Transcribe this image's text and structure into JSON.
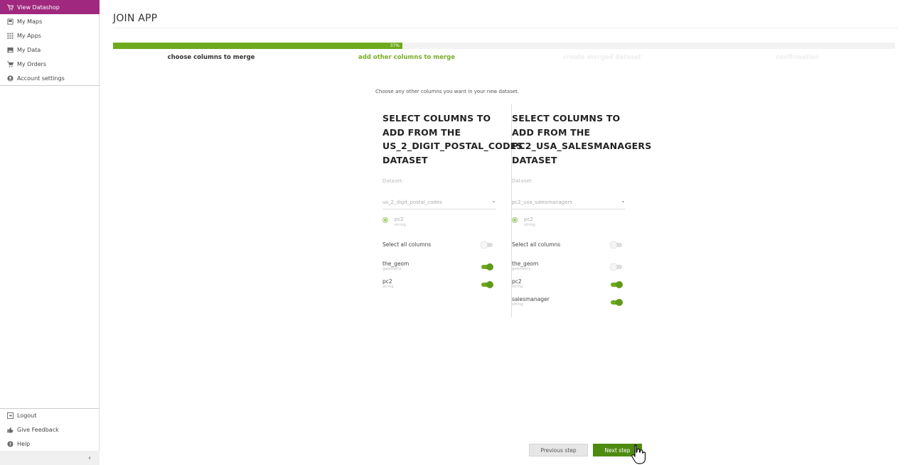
{
  "sidebar": {
    "items": [
      {
        "label": "View Datashop",
        "icon": "cart-icon",
        "active": true
      },
      {
        "label": "My Maps",
        "icon": "maps-icon"
      },
      {
        "label": "My Apps",
        "icon": "apps-grid-icon"
      },
      {
        "label": "My Data",
        "icon": "image-data-icon"
      },
      {
        "label": "My Orders",
        "icon": "cart-icon"
      },
      {
        "label": "Account settings",
        "icon": "account-icon"
      }
    ],
    "bottom": [
      {
        "label": "Logout",
        "icon": "logout-icon"
      },
      {
        "label": "Give Feedback",
        "icon": "thumbs-up-icon"
      },
      {
        "label": "Help",
        "icon": "help-icon"
      }
    ],
    "collapse": "‹"
  },
  "page": {
    "title": "JOIN APP"
  },
  "progress": {
    "percent": 37,
    "label": "37%"
  },
  "steps": [
    {
      "label": "choose columns to merge",
      "state": "done"
    },
    {
      "label": "add other columns to merge",
      "state": "current"
    },
    {
      "label": "create merged dataset",
      "state": "future"
    },
    {
      "label": "confirmation",
      "state": "future"
    }
  ],
  "intro": "Choose any other columns you want in your new dataset.",
  "columns": [
    {
      "title_lines": [
        "SELECT COLUMNS TO",
        "ADD FROM THE",
        "US_2_DIGIT_POSTAL_CODES",
        "DATASET"
      ],
      "dataset_label": "Dataset:",
      "dataset_value": "us_2_digit_postal_codes",
      "key": {
        "name": "pc2",
        "type": "string"
      },
      "select_all": {
        "label": "Select all columns",
        "on": false
      },
      "fields": [
        {
          "name": "the_geom",
          "type": "geometry",
          "on": true
        },
        {
          "name": "pc2",
          "type": "string",
          "on": true
        }
      ]
    },
    {
      "title_lines": [
        "SELECT COLUMNS TO",
        "ADD FROM THE",
        "PC2_USA_SALESMANAGERS",
        "DATASET"
      ],
      "dataset_label": "Dataset:",
      "dataset_value": "pc2_usa_salesmanagers",
      "key": {
        "name": "pc2",
        "type": "string"
      },
      "select_all": {
        "label": "Select all columns",
        "on": false
      },
      "fields": [
        {
          "name": "the_geom",
          "type": "geometry",
          "on": false
        },
        {
          "name": "pc2",
          "type": "string",
          "on": true
        },
        {
          "name": "salesmanager",
          "type": "string",
          "on": true
        }
      ]
    }
  ],
  "buttons": {
    "previous": "Previous step",
    "next": "Next step"
  },
  "colors": {
    "brand": "#a0297f",
    "accent": "#6eaa1e",
    "next_button": "#4f8a10"
  }
}
